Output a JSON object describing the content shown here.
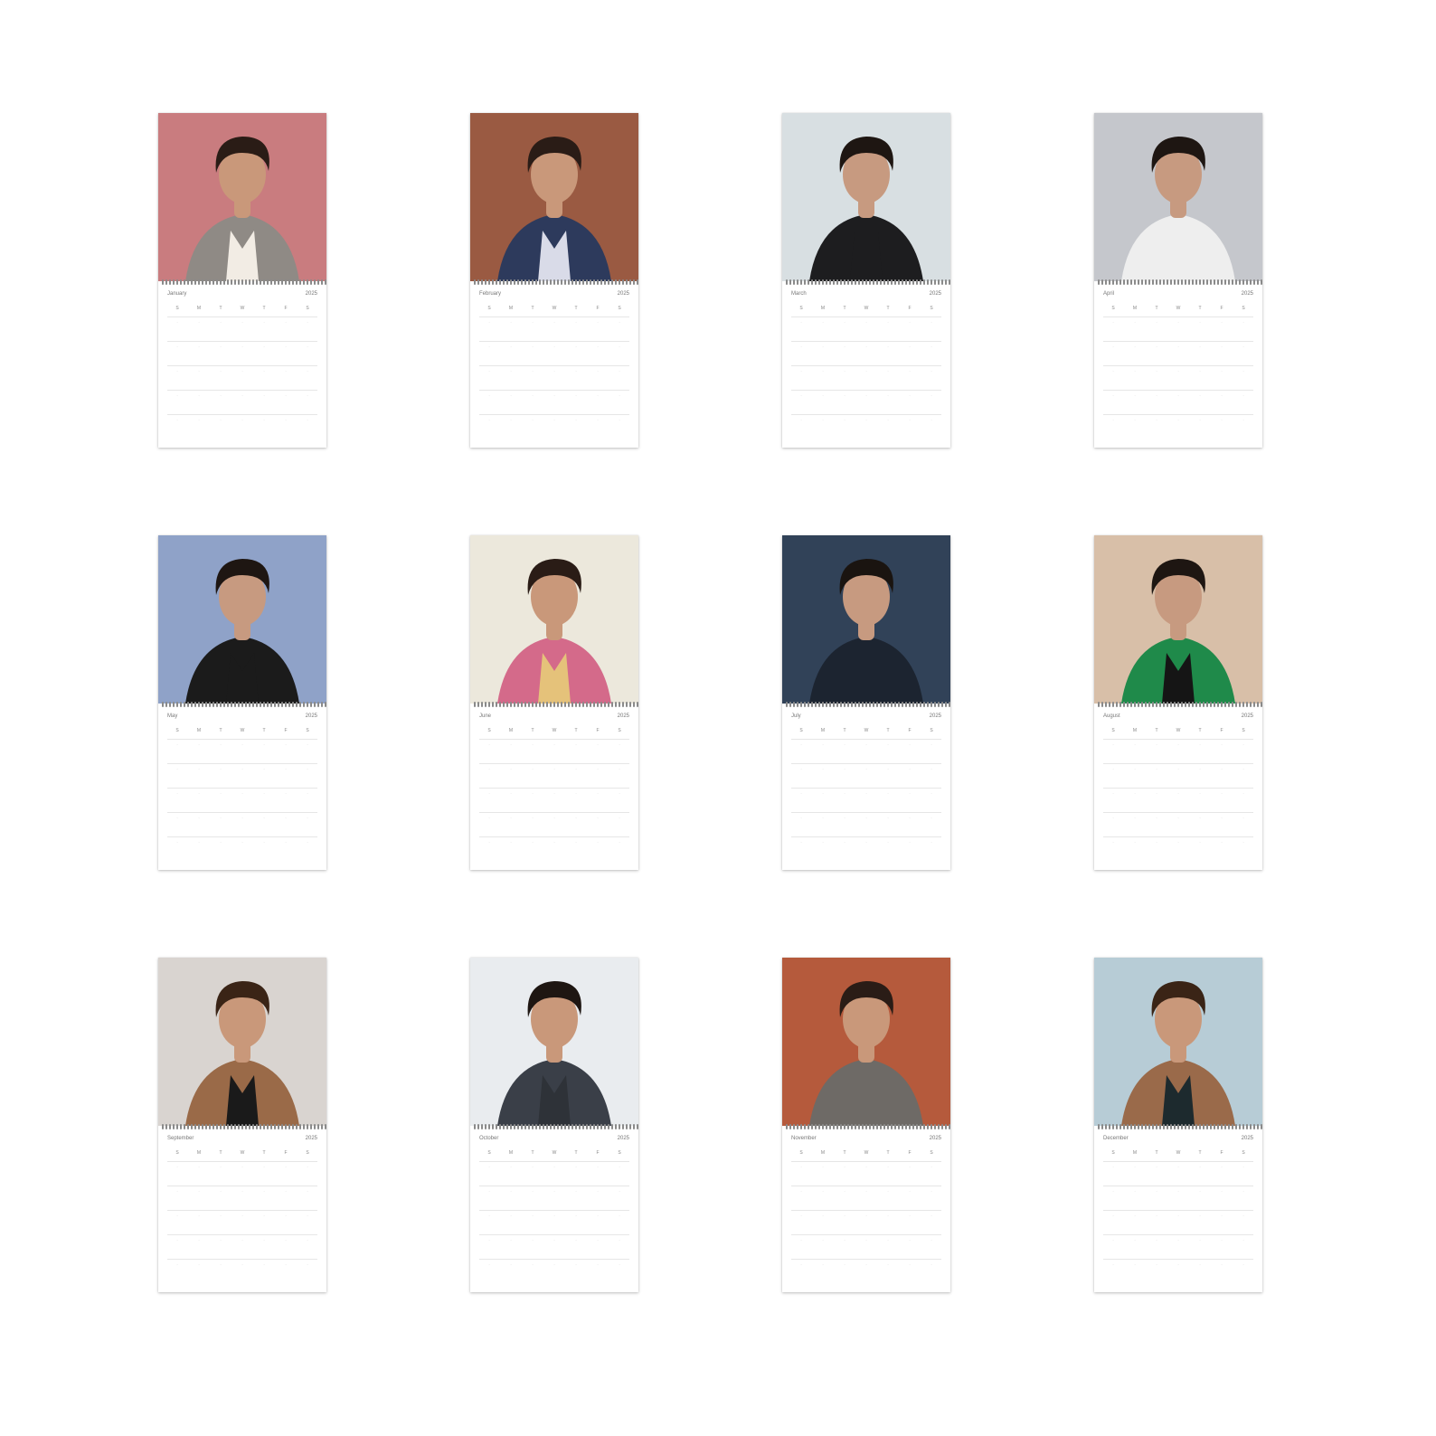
{
  "calendar": {
    "dow": [
      "S",
      "M",
      "T",
      "W",
      "T",
      "F",
      "S"
    ],
    "months": [
      {
        "name": "January",
        "year": "2025",
        "bg": "#c97c7f",
        "skin": "#c9987a",
        "hair": "#2a1c16",
        "shirt": "#f2ece4",
        "jacket": "#8f8a85"
      },
      {
        "name": "February",
        "year": "2025",
        "bg": "#9a5a42",
        "skin": "#c9987a",
        "hair": "#2a1c16",
        "shirt": "#d9dbe8",
        "jacket": "#2d3a5c"
      },
      {
        "name": "March",
        "year": "2025",
        "bg": "#d8dfe2",
        "skin": "#c79a80",
        "hair": "#1e1612",
        "shirt": "#1d1d1f",
        "jacket": "#1d1d1f"
      },
      {
        "name": "April",
        "year": "2025",
        "bg": "#c5c7cc",
        "skin": "#c79a80",
        "hair": "#1e1612",
        "shirt": "#eeeeee",
        "jacket": "#eeeeee"
      },
      {
        "name": "May",
        "year": "2025",
        "bg": "#8fa2c8",
        "skin": "#c79a80",
        "hair": "#1e1612",
        "shirt": "#1b1b1b",
        "jacket": "#1b1b1b"
      },
      {
        "name": "June",
        "year": "2025",
        "bg": "#ece8dc",
        "skin": "#c9987a",
        "hair": "#2a1c16",
        "shirt": "#e5c27a",
        "jacket": "#d46a8a"
      },
      {
        "name": "July",
        "year": "2025",
        "bg": "#314258",
        "skin": "#c79a80",
        "hair": "#1a1410",
        "shirt": "#1c2430",
        "jacket": "#1c2430"
      },
      {
        "name": "August",
        "year": "2025",
        "bg": "#d8bfa8",
        "skin": "#c79a80",
        "hair": "#1e1612",
        "shirt": "#151515",
        "jacket": "#1f8a4a"
      },
      {
        "name": "September",
        "year": "2025",
        "bg": "#d9d4d0",
        "skin": "#c9987a",
        "hair": "#3a2416",
        "shirt": "#1a1a1a",
        "jacket": "#9a6a48"
      },
      {
        "name": "October",
        "year": "2025",
        "bg": "#e9ecef",
        "skin": "#c9987a",
        "hair": "#1e1612",
        "shirt": "#2e3238",
        "jacket": "#3a3f48"
      },
      {
        "name": "November",
        "year": "2025",
        "bg": "#b55a3c",
        "skin": "#c9987a",
        "hair": "#2a1c16",
        "shirt": "#6e6a66",
        "jacket": "#6e6a66"
      },
      {
        "name": "December",
        "year": "2025",
        "bg": "#b7ccd6",
        "skin": "#c9987a",
        "hair": "#3a2416",
        "shirt": "#1d2a2e",
        "jacket": "#9a6a4a"
      }
    ]
  }
}
